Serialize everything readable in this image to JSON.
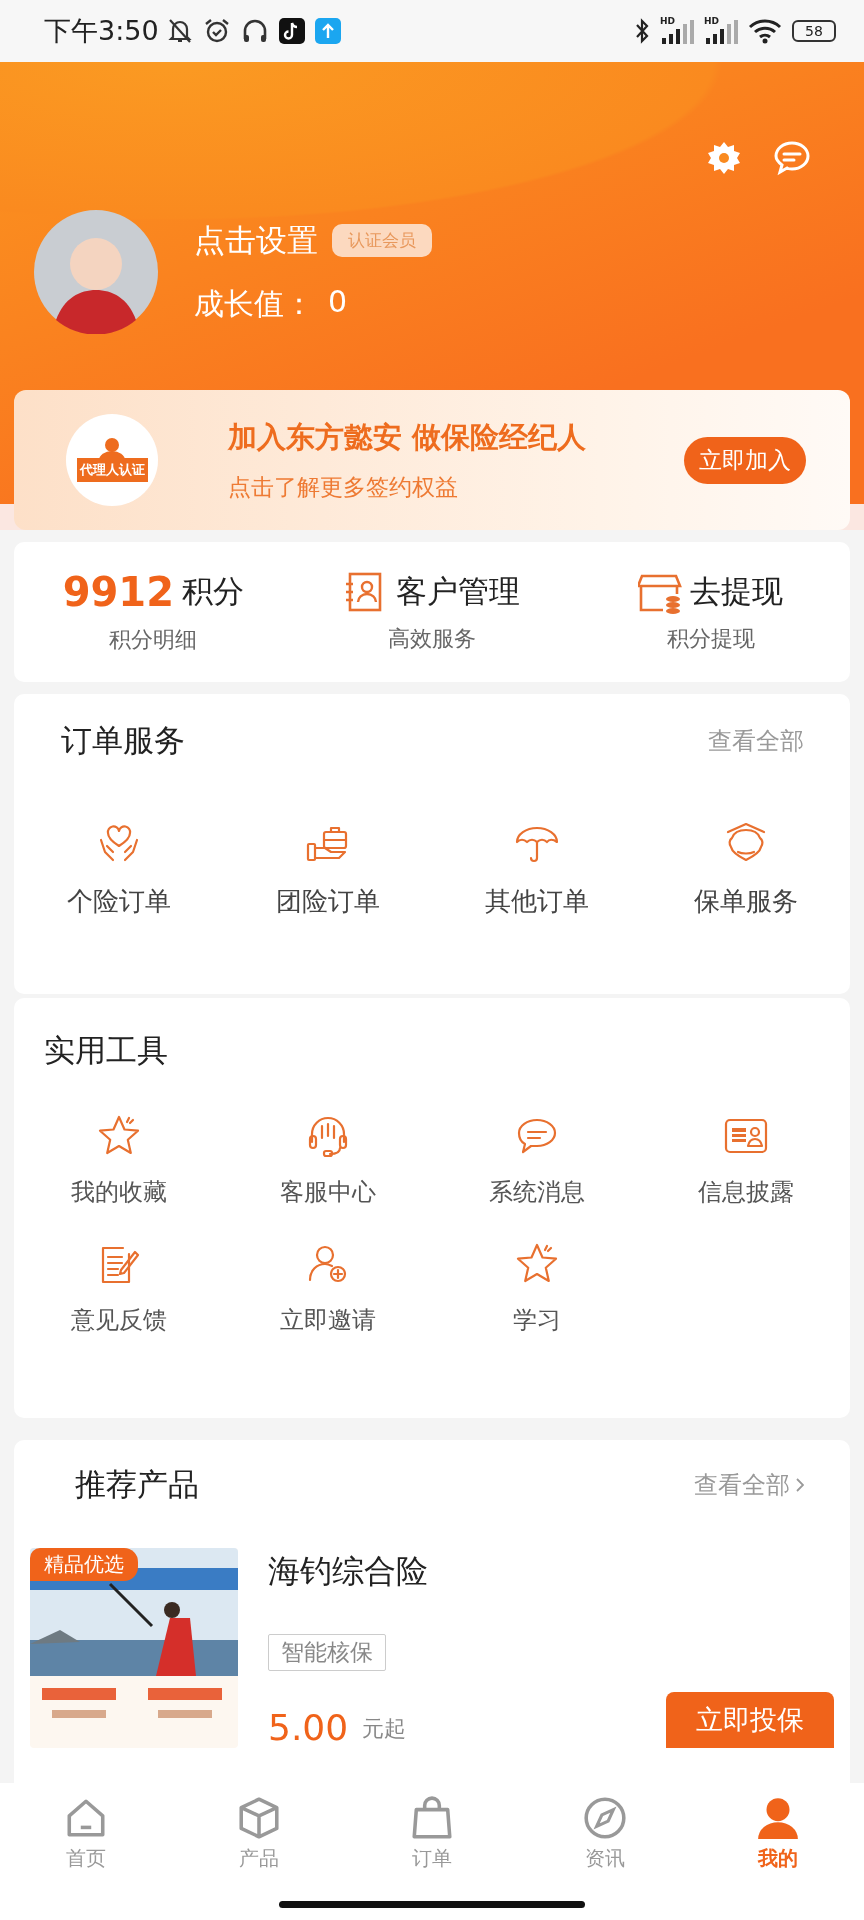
{
  "status_bar": {
    "time": "下午3:50",
    "signal_labels": [
      "HD",
      "HD"
    ],
    "battery": "58"
  },
  "header": {
    "nickname": "点击设置",
    "badge": "认证会员",
    "growth_label": "成长值：",
    "growth_value": "0"
  },
  "join_banner": {
    "icon_label": "代理人认证",
    "title": "加入东方懿安 做保险经纪人",
    "subtitle": "点击了解更多签约权益",
    "button": "立即加入"
  },
  "stats": [
    {
      "kind": "points",
      "value": "9912",
      "label": "积分",
      "caption": "积分明细"
    },
    {
      "kind": "link",
      "label": "客户管理",
      "caption": "高效服务"
    },
    {
      "kind": "link",
      "label": "去提现",
      "caption": "积分提现"
    }
  ],
  "order_services": {
    "title": "订单服务",
    "more": "查看全部",
    "items": [
      "个险订单",
      "团险订单",
      "其他订单",
      "保单服务"
    ]
  },
  "tools": {
    "title": "实用工具",
    "items": [
      "我的收藏",
      "客服中心",
      "系统消息",
      "信息披露",
      "意见反馈",
      "立即邀请",
      "学习"
    ]
  },
  "recommended": {
    "title": "推荐产品",
    "more": "查看全部",
    "products": [
      {
        "badge": "精品优选",
        "name": "海钓综合险",
        "tag": "智能核保",
        "price": "5.00",
        "price_unit": "元起",
        "button": "立即投保"
      }
    ]
  },
  "tab_bar": [
    {
      "label": "首页",
      "selected": false
    },
    {
      "label": "产品",
      "selected": false
    },
    {
      "label": "订单",
      "selected": false
    },
    {
      "label": "资讯",
      "selected": false
    },
    {
      "label": "我的",
      "selected": true
    }
  ]
}
